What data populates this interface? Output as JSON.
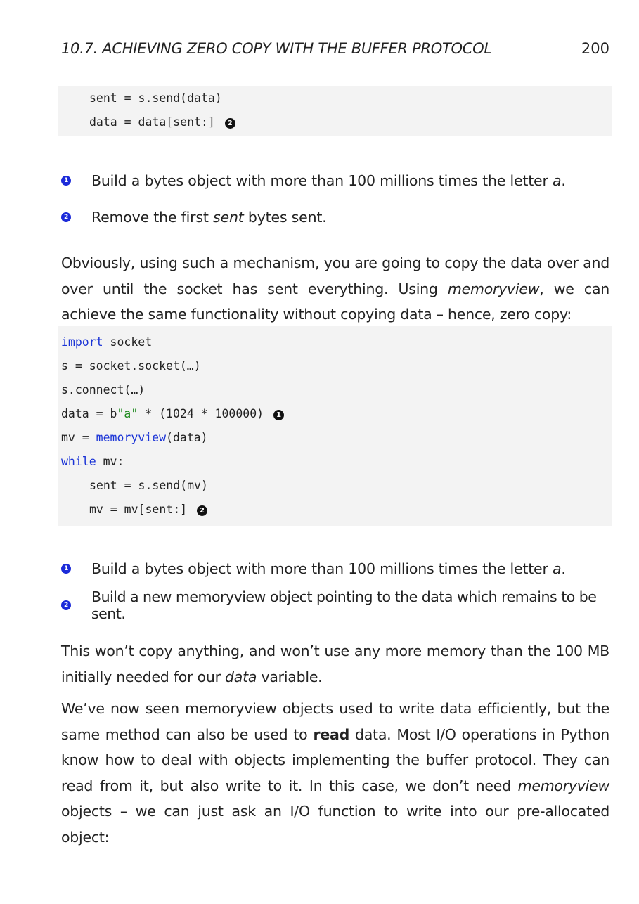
{
  "header": {
    "section_title": "10.7. ACHIEVING ZERO COPY WITH THE BUFFER PROTOCOL",
    "page_number": "200"
  },
  "code1": {
    "line1": "sent = s.send(data)",
    "line2": "data = data[sent:]",
    "mark2": "2"
  },
  "callouts1": [
    {
      "num": "1",
      "pre": "Build a bytes object with more than 100 millions times the letter ",
      "em": "a",
      "post": "."
    },
    {
      "num": "2",
      "pre": "Remove the first ",
      "em": "sent",
      "post": " bytes sent."
    }
  ],
  "para1": {
    "t1": "Obviously, using such a mechanism, you are going to copy the data over and over until the socket has sent everything. Using ",
    "em1": "memoryview",
    "t2": ", we can achieve the same functionality without copying data – hence, zero copy:"
  },
  "code2": {
    "l1_kw": "import",
    "l1_rest": " socket",
    "l2": "s = socket.socket(…)",
    "l3": "s.connect(…)",
    "l4_a": "data = b",
    "l4_str": "\"a\"",
    "l4_b": " * (1024 * 100000)",
    "l4_mark": "1",
    "l5_a": "mv = ",
    "l5_kw": "memoryview",
    "l5_b": "(data)",
    "l6_kw": "while",
    "l6_rest": " mv:",
    "l7": "sent = s.send(mv)",
    "l8": "mv = mv[sent:]",
    "l8_mark": "2"
  },
  "callouts2": [
    {
      "num": "1",
      "pre": "Build a bytes object with more than 100 millions times the letter ",
      "em": "a",
      "post": "."
    },
    {
      "num": "2",
      "text": "Build a new memoryview object pointing to the data which remains to be sent."
    }
  ],
  "para2": {
    "t1": "This won’t copy anything, and won’t use any more memory than the 100 MB initially needed for our ",
    "em1": "data",
    "t2": " variable."
  },
  "para3": {
    "t1": "We’ve now seen memoryview objects used to write data efficiently, but the same method can also be used to ",
    "b1": "read",
    "t2": " data. Most I/O operations in Python know how to deal with objects implementing the buffer protocol. They can read from it, but also write to it. In this case, we don’t need ",
    "em1": "memoryview",
    "t3": " objects – we can just ask an I/O function to write into our pre-allocated object:"
  }
}
